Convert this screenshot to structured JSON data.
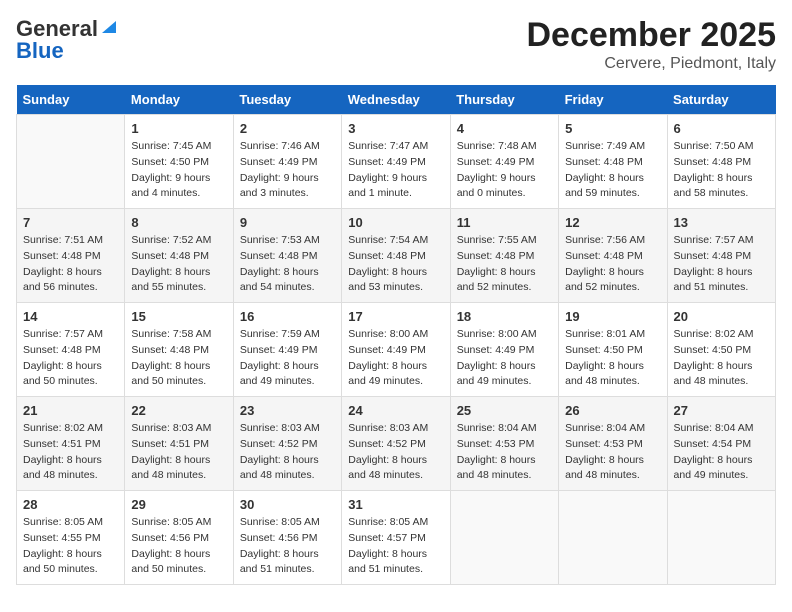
{
  "header": {
    "logo_line1": "General",
    "logo_line2": "Blue",
    "title": "December 2025",
    "subtitle": "Cervere, Piedmont, Italy"
  },
  "calendar": {
    "days_of_week": [
      "Sunday",
      "Monday",
      "Tuesday",
      "Wednesday",
      "Thursday",
      "Friday",
      "Saturday"
    ],
    "weeks": [
      [
        {
          "day": "",
          "info": ""
        },
        {
          "day": "1",
          "info": "Sunrise: 7:45 AM\nSunset: 4:50 PM\nDaylight: 9 hours\nand 4 minutes."
        },
        {
          "day": "2",
          "info": "Sunrise: 7:46 AM\nSunset: 4:49 PM\nDaylight: 9 hours\nand 3 minutes."
        },
        {
          "day": "3",
          "info": "Sunrise: 7:47 AM\nSunset: 4:49 PM\nDaylight: 9 hours\nand 1 minute."
        },
        {
          "day": "4",
          "info": "Sunrise: 7:48 AM\nSunset: 4:49 PM\nDaylight: 9 hours\nand 0 minutes."
        },
        {
          "day": "5",
          "info": "Sunrise: 7:49 AM\nSunset: 4:48 PM\nDaylight: 8 hours\nand 59 minutes."
        },
        {
          "day": "6",
          "info": "Sunrise: 7:50 AM\nSunset: 4:48 PM\nDaylight: 8 hours\nand 58 minutes."
        }
      ],
      [
        {
          "day": "7",
          "info": "Sunrise: 7:51 AM\nSunset: 4:48 PM\nDaylight: 8 hours\nand 56 minutes."
        },
        {
          "day": "8",
          "info": "Sunrise: 7:52 AM\nSunset: 4:48 PM\nDaylight: 8 hours\nand 55 minutes."
        },
        {
          "day": "9",
          "info": "Sunrise: 7:53 AM\nSunset: 4:48 PM\nDaylight: 8 hours\nand 54 minutes."
        },
        {
          "day": "10",
          "info": "Sunrise: 7:54 AM\nSunset: 4:48 PM\nDaylight: 8 hours\nand 53 minutes."
        },
        {
          "day": "11",
          "info": "Sunrise: 7:55 AM\nSunset: 4:48 PM\nDaylight: 8 hours\nand 52 minutes."
        },
        {
          "day": "12",
          "info": "Sunrise: 7:56 AM\nSunset: 4:48 PM\nDaylight: 8 hours\nand 52 minutes."
        },
        {
          "day": "13",
          "info": "Sunrise: 7:57 AM\nSunset: 4:48 PM\nDaylight: 8 hours\nand 51 minutes."
        }
      ],
      [
        {
          "day": "14",
          "info": "Sunrise: 7:57 AM\nSunset: 4:48 PM\nDaylight: 8 hours\nand 50 minutes."
        },
        {
          "day": "15",
          "info": "Sunrise: 7:58 AM\nSunset: 4:48 PM\nDaylight: 8 hours\nand 50 minutes."
        },
        {
          "day": "16",
          "info": "Sunrise: 7:59 AM\nSunset: 4:49 PM\nDaylight: 8 hours\nand 49 minutes."
        },
        {
          "day": "17",
          "info": "Sunrise: 8:00 AM\nSunset: 4:49 PM\nDaylight: 8 hours\nand 49 minutes."
        },
        {
          "day": "18",
          "info": "Sunrise: 8:00 AM\nSunset: 4:49 PM\nDaylight: 8 hours\nand 49 minutes."
        },
        {
          "day": "19",
          "info": "Sunrise: 8:01 AM\nSunset: 4:50 PM\nDaylight: 8 hours\nand 48 minutes."
        },
        {
          "day": "20",
          "info": "Sunrise: 8:02 AM\nSunset: 4:50 PM\nDaylight: 8 hours\nand 48 minutes."
        }
      ],
      [
        {
          "day": "21",
          "info": "Sunrise: 8:02 AM\nSunset: 4:51 PM\nDaylight: 8 hours\nand 48 minutes."
        },
        {
          "day": "22",
          "info": "Sunrise: 8:03 AM\nSunset: 4:51 PM\nDaylight: 8 hours\nand 48 minutes."
        },
        {
          "day": "23",
          "info": "Sunrise: 8:03 AM\nSunset: 4:52 PM\nDaylight: 8 hours\nand 48 minutes."
        },
        {
          "day": "24",
          "info": "Sunrise: 8:03 AM\nSunset: 4:52 PM\nDaylight: 8 hours\nand 48 minutes."
        },
        {
          "day": "25",
          "info": "Sunrise: 8:04 AM\nSunset: 4:53 PM\nDaylight: 8 hours\nand 48 minutes."
        },
        {
          "day": "26",
          "info": "Sunrise: 8:04 AM\nSunset: 4:53 PM\nDaylight: 8 hours\nand 48 minutes."
        },
        {
          "day": "27",
          "info": "Sunrise: 8:04 AM\nSunset: 4:54 PM\nDaylight: 8 hours\nand 49 minutes."
        }
      ],
      [
        {
          "day": "28",
          "info": "Sunrise: 8:05 AM\nSunset: 4:55 PM\nDaylight: 8 hours\nand 50 minutes."
        },
        {
          "day": "29",
          "info": "Sunrise: 8:05 AM\nSunset: 4:56 PM\nDaylight: 8 hours\nand 50 minutes."
        },
        {
          "day": "30",
          "info": "Sunrise: 8:05 AM\nSunset: 4:56 PM\nDaylight: 8 hours\nand 51 minutes."
        },
        {
          "day": "31",
          "info": "Sunrise: 8:05 AM\nSunset: 4:57 PM\nDaylight: 8 hours\nand 51 minutes."
        },
        {
          "day": "",
          "info": ""
        },
        {
          "day": "",
          "info": ""
        },
        {
          "day": "",
          "info": ""
        }
      ]
    ]
  }
}
